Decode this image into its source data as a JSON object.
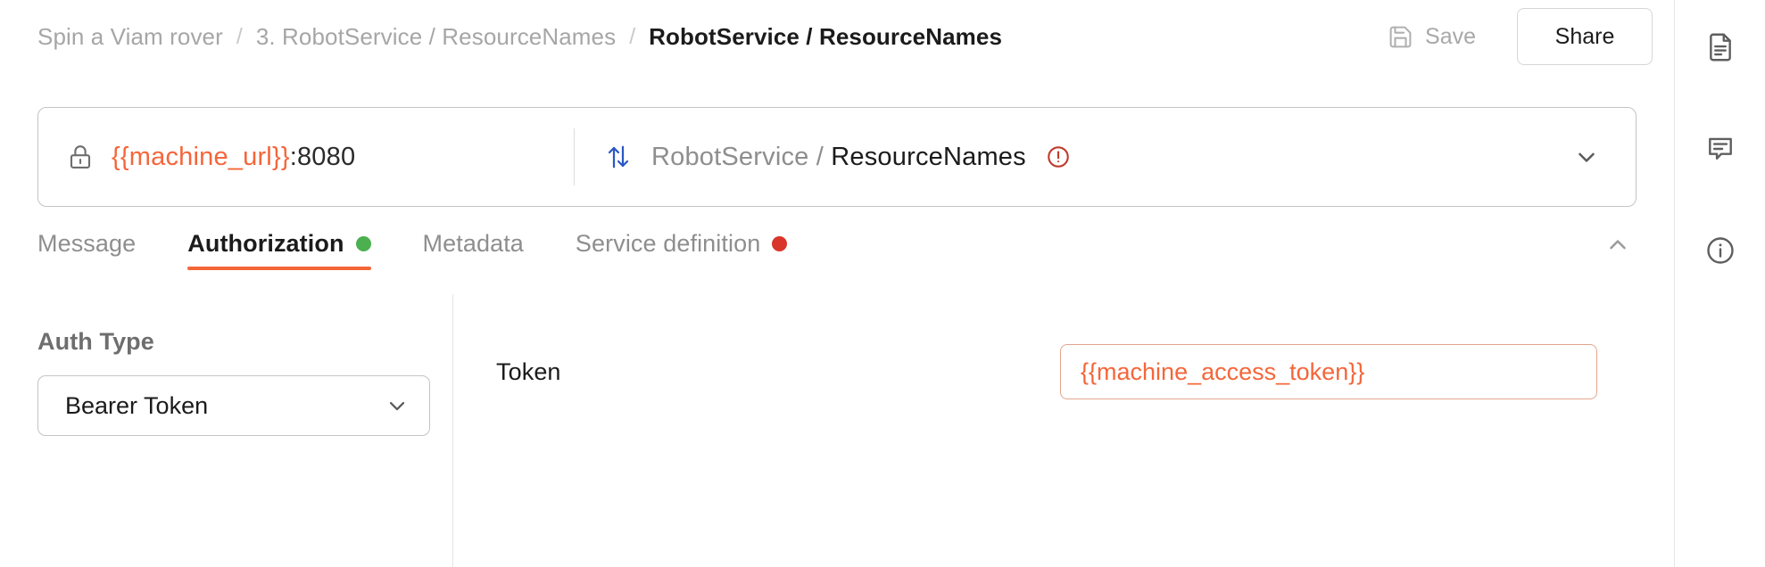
{
  "breadcrumb": {
    "items": [
      {
        "label": "Spin a Viam rover",
        "current": false
      },
      {
        "label": "3. RobotService / ResourceNames",
        "current": false
      },
      {
        "label": "RobotService / ResourceNames",
        "current": true
      }
    ],
    "separator": "/"
  },
  "header": {
    "save_label": "Save",
    "save_icon": "floppy-disk-save-icon",
    "share_label": "Share"
  },
  "request_bar": {
    "lock_icon": "lock-icon",
    "url_variable": "{{machine_url}}",
    "url_port": ":8080",
    "method_icon": "bidirectional-arrows-icon",
    "method_service": "RobotService /",
    "method_name": "ResourceNames",
    "method_warning_icon": "error-circle-icon",
    "dropdown_icon": "chevron-down-icon"
  },
  "tabs": [
    {
      "label": "Message",
      "active": false,
      "dot": null
    },
    {
      "label": "Authorization",
      "active": true,
      "dot": "green"
    },
    {
      "label": "Metadata",
      "active": false,
      "dot": null
    },
    {
      "label": "Service definition",
      "active": false,
      "dot": "red"
    }
  ],
  "collapse_icon": "chevron-up-icon",
  "auth": {
    "type_label": "Auth Type",
    "type_value": "Bearer Token",
    "type_dropdown_icon": "chevron-down-icon",
    "token_key": "Token",
    "token_value": "{{machine_access_token}}"
  },
  "sidebar": {
    "items": [
      {
        "name": "documentation-icon"
      },
      {
        "name": "comments-icon"
      },
      {
        "name": "info-icon"
      }
    ]
  },
  "colors": {
    "accent_orange": "#f4663a",
    "status_green": "#4caf50",
    "status_red": "#d9352a",
    "method_blue": "#2b58c4"
  }
}
